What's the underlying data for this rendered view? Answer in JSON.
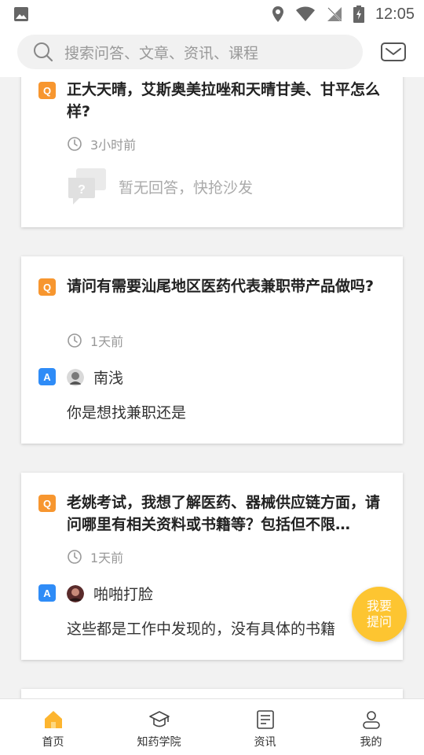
{
  "status_bar": {
    "time": "12:05"
  },
  "search": {
    "placeholder": "搜索问答、文章、资讯、课程"
  },
  "questions": [
    {
      "title": "正大天晴，艾斯奥美拉唑和天晴甘美、甘平怎么样?",
      "time": "3小时前",
      "no_answer_text": "暂无回答，快抢沙发"
    },
    {
      "title": "请问有需要汕尾地区医药代表兼职带产品做吗?",
      "time": "1天前",
      "answerer": "南浅",
      "answer": "你是想找兼职还是"
    },
    {
      "title": "老姚考试，我想了解医药、器械供应链方面，请问哪里有相关资料或书籍等？包括但不限…",
      "time": "1天前",
      "answerer": "啪啪打脸",
      "answer": "这些都是工作中发现的，没有具体的书籍"
    }
  ],
  "badges": {
    "q": "Q",
    "a": "A"
  },
  "fab": {
    "line1": "我要",
    "line2": "提问"
  },
  "tabs": [
    {
      "label": "首页",
      "icon": "home-icon",
      "active": true
    },
    {
      "label": "知药学院",
      "icon": "graduation-cap-icon"
    },
    {
      "label": "资讯",
      "icon": "news-icon"
    },
    {
      "label": "我的",
      "icon": "user-icon"
    }
  ],
  "colors": {
    "accent": "#f7962f",
    "answer_badge": "#2f8cf7",
    "fab": "#fdc531",
    "active_tab_icon": "#fdb52f"
  }
}
